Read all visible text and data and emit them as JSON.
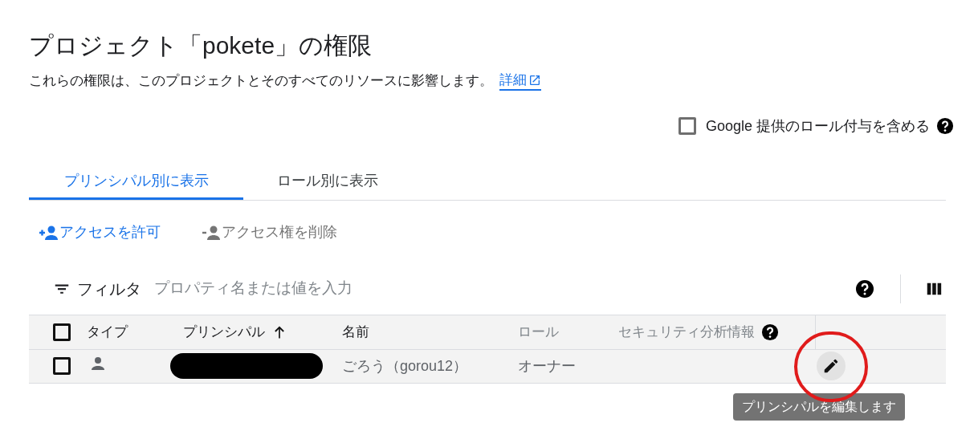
{
  "title": "プロジェクト「pokete」の権限",
  "description": "これらの権限は、このプロジェクトとそのすべてのリソースに影響します。",
  "details_link": "詳細",
  "include_google_grants": {
    "label": "Google 提供のロール付与を含める",
    "checked": false
  },
  "tabs": [
    {
      "label": "プリンシパル別に表示",
      "selected": true
    },
    {
      "label": "ロール別に表示",
      "selected": false
    }
  ],
  "actions": [
    {
      "kind": "grant",
      "label": "アクセスを許可",
      "disabled": false
    },
    {
      "kind": "remove",
      "label": "アクセス権を削除",
      "disabled": true
    }
  ],
  "filter": {
    "label": "フィルタ",
    "placeholder": "プロパティ名または値を入力"
  },
  "table": {
    "header_checked": false,
    "columns": [
      {
        "label": "タイプ",
        "sortable": true,
        "sorted": false,
        "help": false
      },
      {
        "label": "プリンシパル",
        "sortable": true,
        "sorted": true,
        "help": false
      },
      {
        "label": "名前",
        "sortable": true,
        "sorted": false,
        "help": false
      },
      {
        "label": "ロール",
        "sortable": false,
        "sorted": false,
        "help": false
      },
      {
        "label": "セキュリティ分析情報",
        "sortable": false,
        "sorted": false,
        "help": true
      }
    ],
    "rows": [
      {
        "checked": false,
        "principal_redacted": true,
        "name": "ごろう（gorou12）",
        "role": "オーナー",
        "edit_hovered": true
      }
    ]
  },
  "tooltip": "プリンシパルを編集します"
}
